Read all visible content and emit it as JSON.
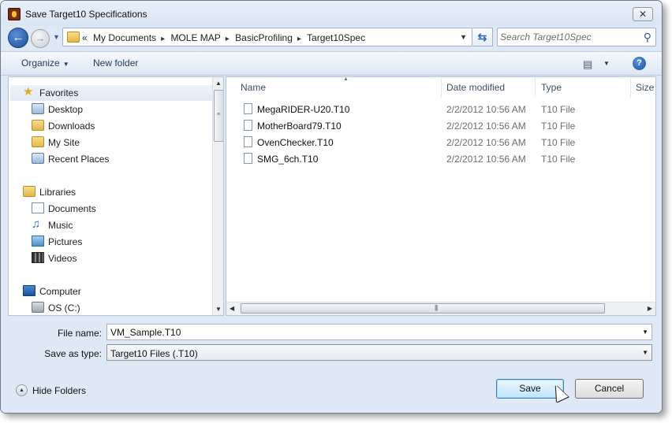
{
  "window": {
    "title": "Save Target10 Specifications",
    "close_glyph": "✕"
  },
  "address": {
    "overflow": "«",
    "crumbs": [
      "My Documents",
      "MOLE MAP",
      "BasicProfiling",
      "Target10Spec"
    ],
    "separator": "▸"
  },
  "search": {
    "placeholder": "Search Target10Spec"
  },
  "toolbar": {
    "organize": "Organize",
    "new_folder": "New folder",
    "help": "?"
  },
  "nav": {
    "favorites": {
      "label": "Favorites",
      "items": [
        "Desktop",
        "Downloads",
        "My Site",
        "Recent Places"
      ]
    },
    "libraries": {
      "label": "Libraries",
      "items": [
        "Documents",
        "Music",
        "Pictures",
        "Videos"
      ]
    },
    "computer": {
      "label": "Computer",
      "items": [
        "OS (C:)"
      ]
    }
  },
  "columns": {
    "name": "Name",
    "date": "Date modified",
    "type": "Type",
    "size": "Size"
  },
  "files": [
    {
      "name": "MegaRIDER-U20.T10",
      "date": "2/2/2012 10:56 AM",
      "type": "T10 File"
    },
    {
      "name": "MotherBoard79.T10",
      "date": "2/2/2012 10:56 AM",
      "type": "T10 File"
    },
    {
      "name": "OvenChecker.T10",
      "date": "2/2/2012 10:56 AM",
      "type": "T10 File"
    },
    {
      "name": "SMG_6ch.T10",
      "date": "2/2/2012 10:56 AM",
      "type": "T10 File"
    }
  ],
  "form": {
    "file_name_label": "File name:",
    "file_name_value": "VM_Sample.T10",
    "save_type_label": "Save as type:",
    "save_type_value": "Target10 Files (.T10)"
  },
  "footer": {
    "hide_folders": "Hide Folders",
    "save": "Save",
    "cancel": "Cancel"
  },
  "colors": {
    "window_bg": "#dfe9f5",
    "accent": "#1d4f9c",
    "secondary_text": "#6d6d6d"
  }
}
